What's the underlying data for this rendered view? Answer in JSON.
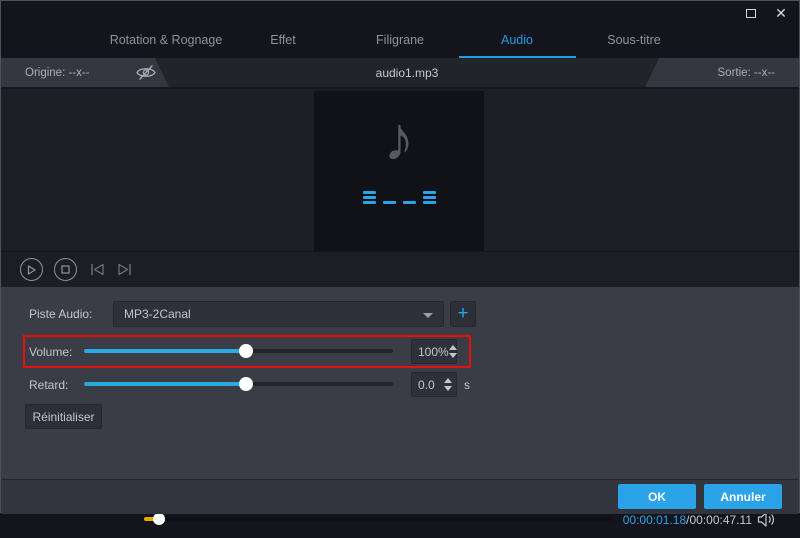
{
  "window": {
    "close_icon": "✕"
  },
  "tabs": [
    {
      "label": "Rotation & Rognage"
    },
    {
      "label": "Effet"
    },
    {
      "label": "Filigrane"
    },
    {
      "label": "Audio"
    },
    {
      "label": "Sous-titre"
    }
  ],
  "file_bar": {
    "origin_label": "Origine: --x--",
    "filename": "audio1.mp3",
    "output_label": "Sortie: --x--"
  },
  "preview": {
    "note_icon": "♪"
  },
  "player": {
    "current_time": "00:00:01.18",
    "time_separator": "/",
    "total_time": "00:00:47.11"
  },
  "settings": {
    "audio_track": {
      "label": "Piste Audio:",
      "value": "MP3-2Canal",
      "add_label": "+"
    },
    "volume": {
      "label": "Volume:",
      "value": "100%"
    },
    "delay": {
      "label": "Retard:",
      "value": "0.0",
      "unit": "s"
    },
    "reset_label": "Réinitialiser"
  },
  "footer": {
    "ok_label": "OK",
    "cancel_label": "Annuler"
  },
  "colors": {
    "accent": "#1f9ce3",
    "progress": "#efa400",
    "highlight_border": "#e8100d",
    "panel": "#3a3d46"
  }
}
